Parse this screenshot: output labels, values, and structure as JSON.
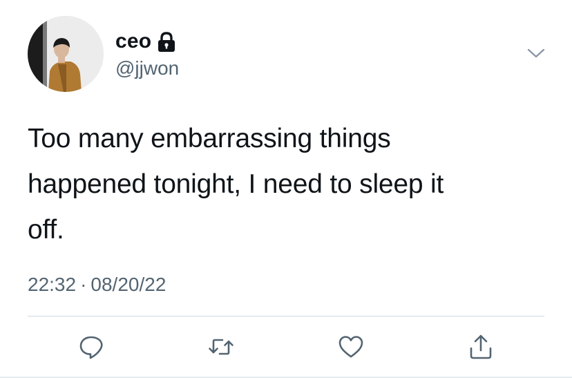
{
  "tweet": {
    "author": {
      "display_name": "ceo",
      "handle": "@jjwon",
      "protected_icon": "lock-icon",
      "avatar": "profile-photo"
    },
    "menu_icon": "chevron-down-icon",
    "text": "Too many embarrassing things\nhappened tonight, I need to sleep it\noff.",
    "time": "22:32",
    "separator": "·",
    "date": "08/20/22",
    "actions": [
      {
        "name": "reply",
        "icon": "reply-icon"
      },
      {
        "name": "retweet",
        "icon": "retweet-icon"
      },
      {
        "name": "like",
        "icon": "heart-icon"
      },
      {
        "name": "share",
        "icon": "share-icon"
      }
    ]
  },
  "colors": {
    "text_primary": "#0f1419",
    "text_secondary": "#536471",
    "icon": "#536471",
    "divider": "#cfd9de"
  }
}
